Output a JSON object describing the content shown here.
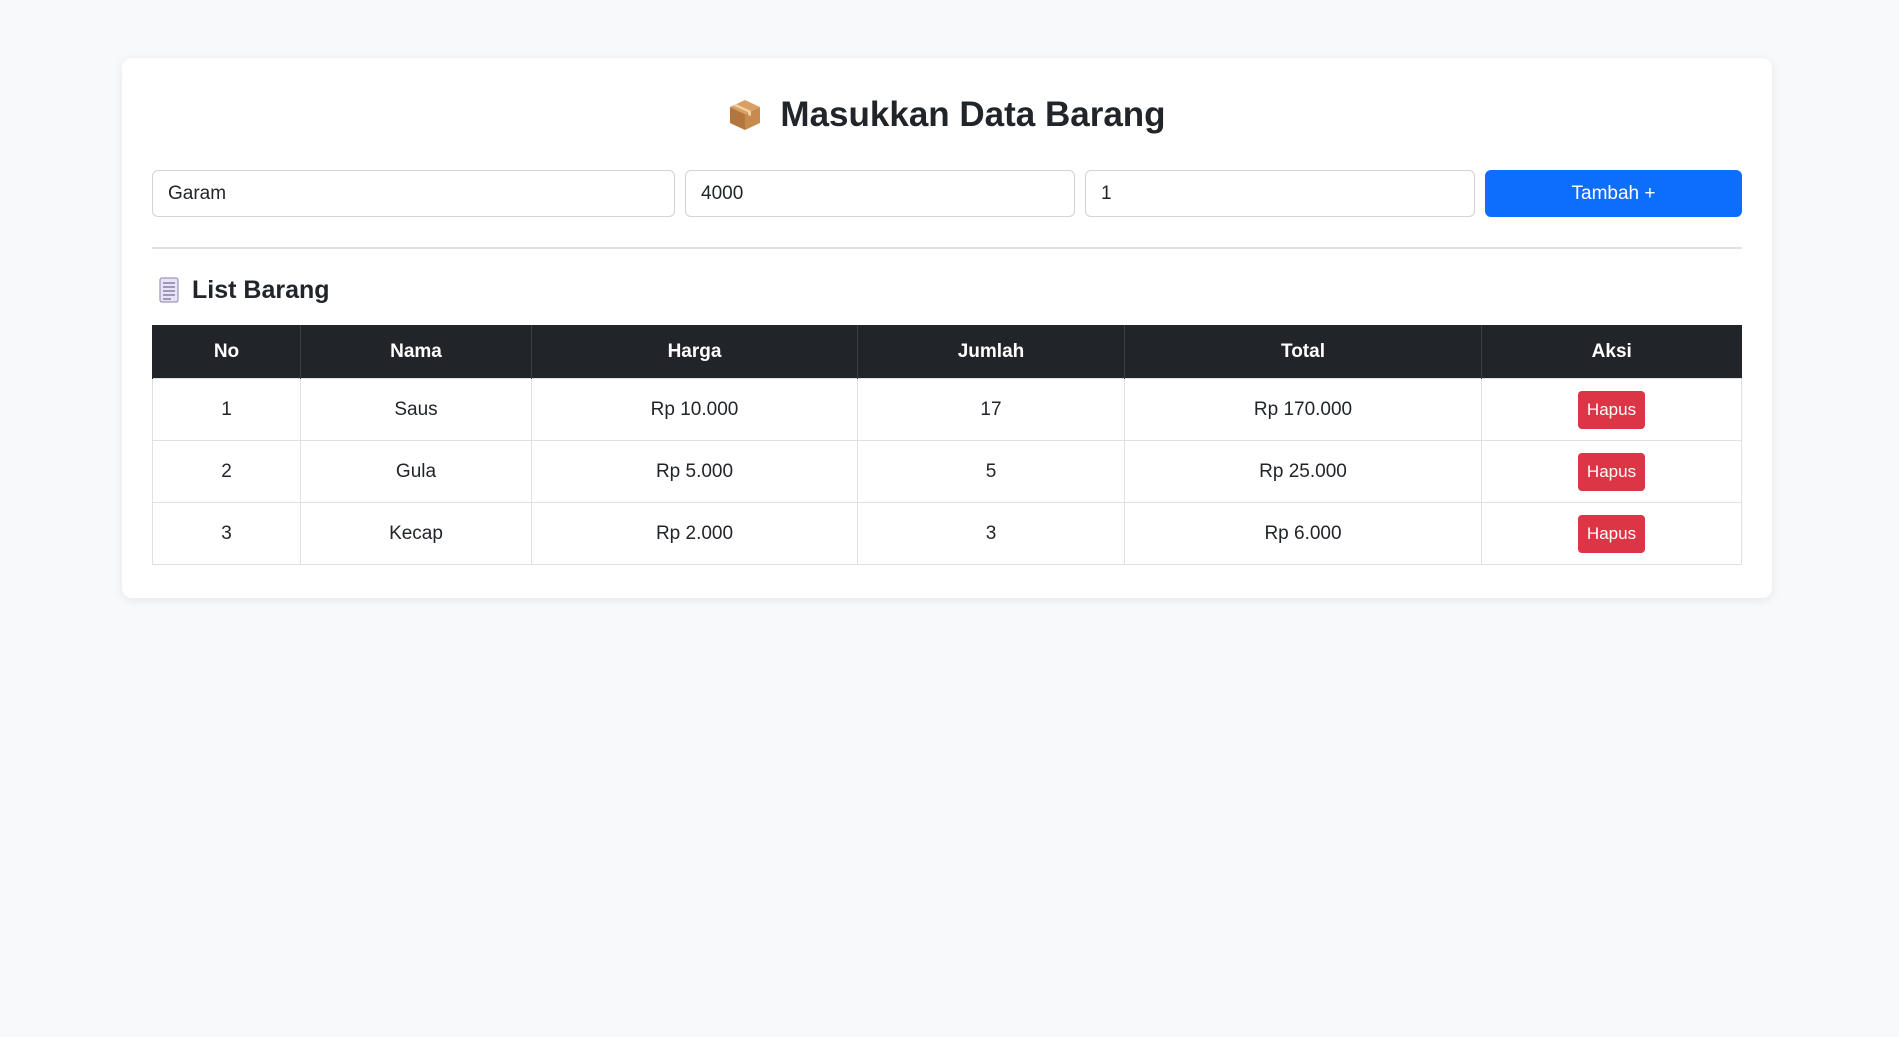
{
  "header": {
    "title": "Masukkan Data Barang",
    "icon": "package-icon"
  },
  "form": {
    "nama_value": "Garam",
    "harga_value": "4000",
    "jumlah_value": "1",
    "submit_label": "Tambah +"
  },
  "list": {
    "title": "List Barang",
    "icon": "document-icon",
    "columns": [
      "No",
      "Nama",
      "Harga",
      "Jumlah",
      "Total",
      "Aksi"
    ],
    "rows": [
      {
        "no": "1",
        "nama": "Saus",
        "harga": "Rp 10.000",
        "jumlah": "17",
        "total": "Rp 170.000",
        "aksi": "Hapus"
      },
      {
        "no": "2",
        "nama": "Gula",
        "harga": "Rp 5.000",
        "jumlah": "5",
        "total": "Rp 25.000",
        "aksi": "Hapus"
      },
      {
        "no": "3",
        "nama": "Kecap",
        "harga": "Rp 2.000",
        "jumlah": "3",
        "total": "Rp 6.000",
        "aksi": "Hapus"
      }
    ]
  },
  "colors": {
    "primary": "#0d6efd",
    "danger": "#dc3545",
    "table_header": "#212529",
    "background": "#f8f9fa"
  }
}
